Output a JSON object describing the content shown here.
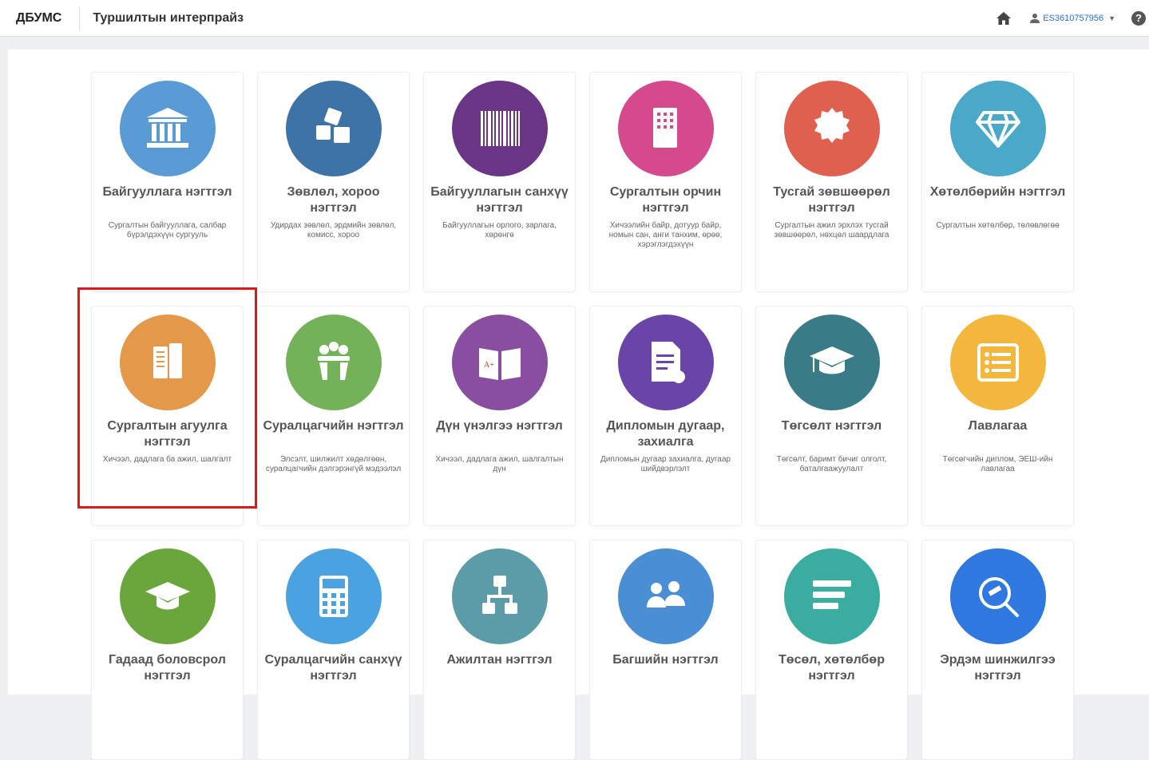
{
  "header": {
    "brand": "ДБУМС",
    "title": "Туршилтын интерпрайз",
    "user": "ES3610757956",
    "help": "?"
  },
  "cards": [
    {
      "title": "Байгууллага нэгтгэл",
      "desc": "Сургалтын байгууллага, салбар бүрэлдэхүүн сургууль",
      "color": "#5b9bd5",
      "icon": "bank-icon"
    },
    {
      "title": "Зөвлөл, хороо нэгтгэл",
      "desc": "Удирдах зөвлөл, эрдмийн зөвлөл, комисс, хороо",
      "color": "#3e73a8",
      "icon": "cubes-icon"
    },
    {
      "title": "Байгууллагын санхүү нэгтгэл",
      "desc": "Байгууллагын орлого, зарлага, хөрөнгө",
      "color": "#6b3585",
      "icon": "barcode-icon"
    },
    {
      "title": "Сургалтын орчин нэгтгэл",
      "desc": "Хичээлийн байр, дотуур байр, номын сан, анги танхим, өрөө, хэрэглэгдэхүүн",
      "color": "#d44a8c",
      "icon": "building-icon"
    },
    {
      "title": "Тусгай зөвшөөрөл нэгтгэл",
      "desc": "Сургалтын ажил эрхлэх тусгай зөвшөөрөл, нөхцөл шаардлага",
      "color": "#e06050",
      "icon": "certificate-icon"
    },
    {
      "title": "Хөтөлбөрийн нэгтгэл",
      "desc": "Сургалтын хөтөлбөр, төлөвлөгөө",
      "color": "#4aa8c8",
      "icon": "diamond-icon"
    },
    {
      "title": "Сургалтын агуулга нэгтгэл",
      "desc": "Хичээл, дадлага ба ажил, шалгалт",
      "color": "#e3984a",
      "icon": "book-icon"
    },
    {
      "title": "Суралцагчийн нэгтгэл",
      "desc": "Элсэлт, шилжилт хөдөлгөөн, суралцагчийн дэлгэрэнгүй мэдээлэл",
      "color": "#74b25a",
      "icon": "students-icon"
    },
    {
      "title": "Дүн үнэлгээ нэгтгэл",
      "desc": "Хичээл, дадлага ажил, шалгалтын дүн",
      "color": "#8a4ea0",
      "icon": "grade-book-icon"
    },
    {
      "title": "Дипломын дугаар, захиалга",
      "desc": "Дипломын дугаар захиалга, дугаар шийдвэрлэлт",
      "color": "#6a45a8",
      "icon": "document-gear-icon"
    },
    {
      "title": "Төгсөлт нэгтгэл",
      "desc": "Төгсөлт, баримт бичиг олголт, баталгаажуулалт",
      "color": "#3a7b88",
      "icon": "graduation-cap-icon"
    },
    {
      "title": "Лавлагаа",
      "desc": "Төгсөгчийн диплом, ЭЕШ-ийн лавлагаа",
      "color": "#f3b73e",
      "icon": "list-icon"
    },
    {
      "title": "Гадаад боловсрол нэгтгэл",
      "desc": "",
      "color": "#6aa63c",
      "icon": "graduation-hat-icon"
    },
    {
      "title": "Суралцагчийн санхүү нэгтгэл",
      "desc": "",
      "color": "#4aa3e0",
      "icon": "calculator-icon"
    },
    {
      "title": "Ажилтан нэгтгэл",
      "desc": "",
      "color": "#5c9ba8",
      "icon": "org-chart-icon"
    },
    {
      "title": "Багшийн нэгтгэл",
      "desc": "",
      "color": "#4a8fd4",
      "icon": "teachers-icon"
    },
    {
      "title": "Төсөл, хөтөлбөр нэгтгэл",
      "desc": "",
      "color": "#3aaca0",
      "icon": "project-icon"
    },
    {
      "title": "Эрдэм шинжилгээ нэгтгэл",
      "desc": "",
      "color": "#2f78e0",
      "icon": "research-icon"
    }
  ]
}
